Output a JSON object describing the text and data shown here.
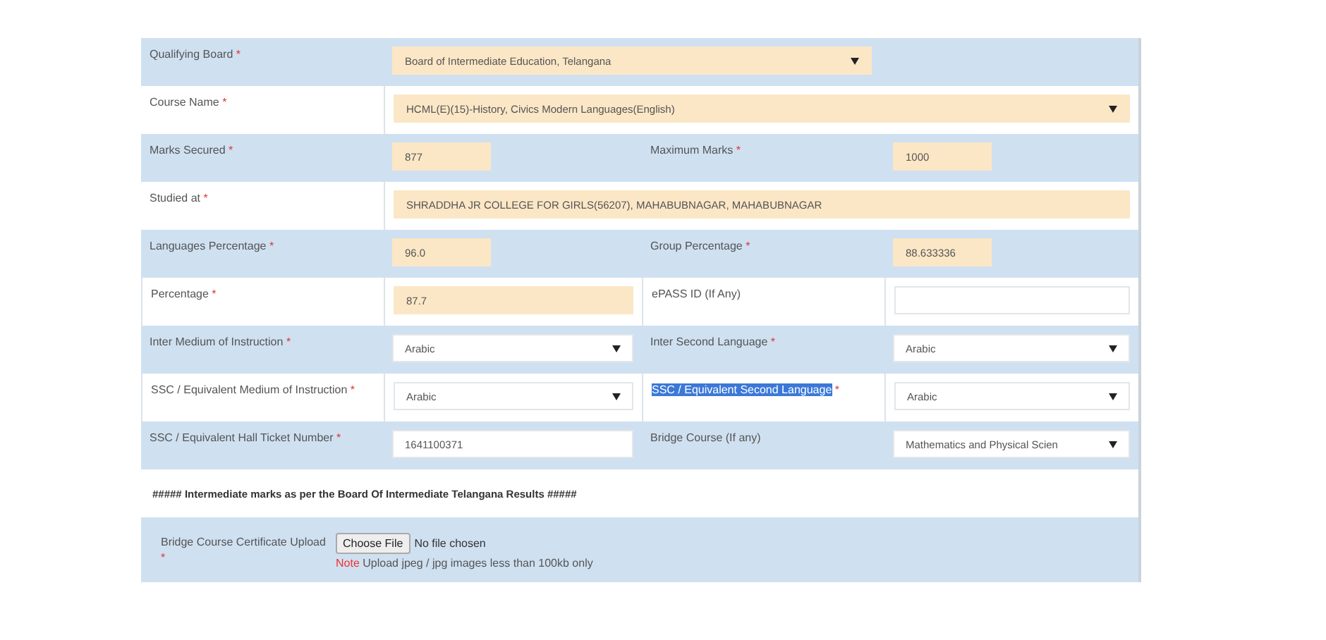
{
  "form": {
    "rows": [
      {
        "kind": "fields",
        "fields": [
          {
            "label": "Qualifying Board",
            "marker": "*",
            "control": {
              "kind": "half-select",
              "value": "Board of Intermediate Education, Telangana",
              "readonly": true
            }
          }
        ]
      },
      {
        "kind": "fields",
        "fields": [
          {
            "label": "Course Name",
            "marker": "*",
            "control": {
              "kind": "select",
              "value": "HCML(E)(15)-History, Civics Modern Languages(English)",
              "readonly": true
            }
          }
        ]
      },
      {
        "kind": "fields",
        "fields": [
          {
            "label": "Marks Secured",
            "marker": "*",
            "control": {
              "kind": "short-input",
              "value": "877",
              "readonly": true
            }
          },
          {
            "label": "Maximum Marks",
            "marker": "*",
            "control": {
              "kind": "short-input",
              "value": "1000",
              "readonly": true
            }
          }
        ]
      },
      {
        "kind": "fields",
        "fields": [
          {
            "label": "Studied at",
            "marker": "*",
            "control": {
              "kind": "input",
              "value": "SHRADDHA JR COLLEGE FOR GIRLS(56207), MAHABUBNAGAR, MAHABUBNAGAR",
              "readonly": true
            }
          }
        ]
      },
      {
        "kind": "fields",
        "fields": [
          {
            "label": "Languages Percentage",
            "marker": "*",
            "control": {
              "kind": "short-input",
              "value": "96.0",
              "readonly": true
            }
          },
          {
            "label": "Group Percentage",
            "marker": "*",
            "control": {
              "kind": "short-input",
              "value": "88.633336",
              "readonly": true
            }
          }
        ]
      },
      {
        "kind": "fields",
        "fields": [
          {
            "label": "Percentage",
            "marker": "*",
            "control": {
              "kind": "input",
              "value": "87.7",
              "readonly": true
            }
          },
          {
            "label": "ePASS ID (If Any)",
            "control": {
              "kind": "input",
              "readonly": false
            }
          }
        ]
      },
      {
        "kind": "fields",
        "fields": [
          {
            "label": "Inter Medium of Instruction",
            "marker": "*",
            "control": {
              "kind": "select",
              "value": "Arabic",
              "readonly": false
            }
          },
          {
            "label": "Inter Second Language",
            "marker": "*",
            "control": {
              "kind": "select",
              "value": "Arabic",
              "readonly": false
            }
          }
        ]
      },
      {
        "kind": "fields",
        "fields": [
          {
            "label": "SSC / Equivalent Medium of Instruction",
            "marker": "*",
            "control": {
              "kind": "select",
              "value": "Arabic",
              "readonly": false
            }
          },
          {
            "label": "SSC / Equivalent Second Language",
            "marker": "*",
            "text_selected": true,
            "control": {
              "kind": "select",
              "value": "Arabic",
              "readonly": false
            }
          }
        ]
      },
      {
        "kind": "fields",
        "fields": [
          {
            "label": "SSC / Equivalent Hall Ticket Number",
            "marker": "*",
            "control": {
              "kind": "input",
              "value": "1641100371",
              "readonly": false
            }
          },
          {
            "label": "Bridge Course (If any)",
            "control": {
              "kind": "select",
              "value": "Mathematics and Physical Scien",
              "readonly": false
            }
          }
        ]
      },
      {
        "kind": "note",
        "text": "##### Intermediate marks as per the Board Of Intermediate Telangana Results #####"
      },
      {
        "kind": "upload",
        "label": "Bridge Course Certificate Upload",
        "marker": "*",
        "button": "Choose File",
        "status": "No file chosen",
        "note_label": "Note",
        "note": "Upload jpeg / jpg images less than 100kb only"
      }
    ]
  }
}
